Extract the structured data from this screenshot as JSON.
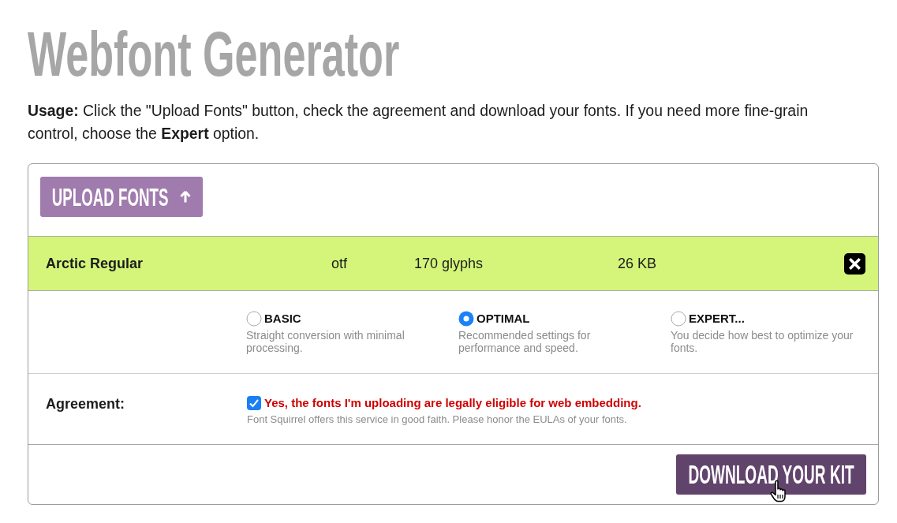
{
  "title": "Webfont Generator",
  "usage": "**Usage:** Click the \"Upload Fonts\" button, check the agreement and download your fonts. If you need more fine-grain control, choose the **Expert** option.",
  "upload_button": {
    "label": "UPLOAD FONTS"
  },
  "fonts": [
    {
      "name": "Arctic Regular",
      "format": "otf",
      "glyphs": "170 glyphs",
      "size": "26 KB"
    }
  ],
  "modes": [
    {
      "label": "BASIC",
      "description": "Straight conversion with minimal processing.",
      "selected": false
    },
    {
      "label": "OPTIMAL",
      "description": "Recommended settings for performance and speed.",
      "selected": true
    },
    {
      "label": "EXPERT...",
      "description": "You decide how best to optimize your fonts.",
      "selected": false
    }
  ],
  "agreement": {
    "label": "Agreement:",
    "checked": true,
    "statement": "Yes, the fonts I'm uploading are legally eligible for web embedding.",
    "note": "Font Squirrel offers this service in good faith. Please honor the EULAs of your fonts."
  },
  "download_button": {
    "label": "DOWNLOAD YOUR KIT"
  }
}
